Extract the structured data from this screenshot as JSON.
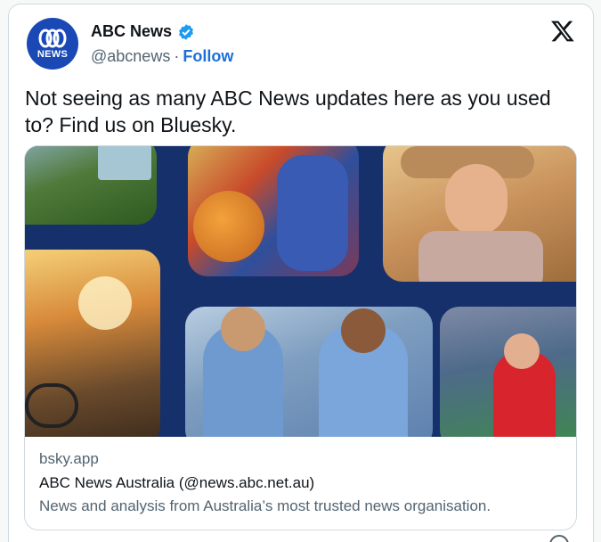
{
  "header": {
    "display_name": "ABC News",
    "handle": "@abcnews",
    "separator": "·",
    "follow_label": "Follow",
    "avatar_text": "NEWS"
  },
  "tweet": {
    "text": "Not seeing as many ABC News updates here as you used to? Find us on Bluesky."
  },
  "link_card": {
    "domain": "bsky.app",
    "title": "ABC News Australia (@news.abc.net.au)",
    "description": "News and analysis from Australia’s most trusted news organisation."
  },
  "colors": {
    "brand_blue": "#1a49b5",
    "link_blue": "#1d6fd8",
    "hero_navy": "#16306c",
    "verified_blue": "#1d9bf0"
  },
  "icons": {
    "verified": "verified-badge-icon",
    "x": "x-logo-icon",
    "abc": "abc-logo-icon"
  }
}
